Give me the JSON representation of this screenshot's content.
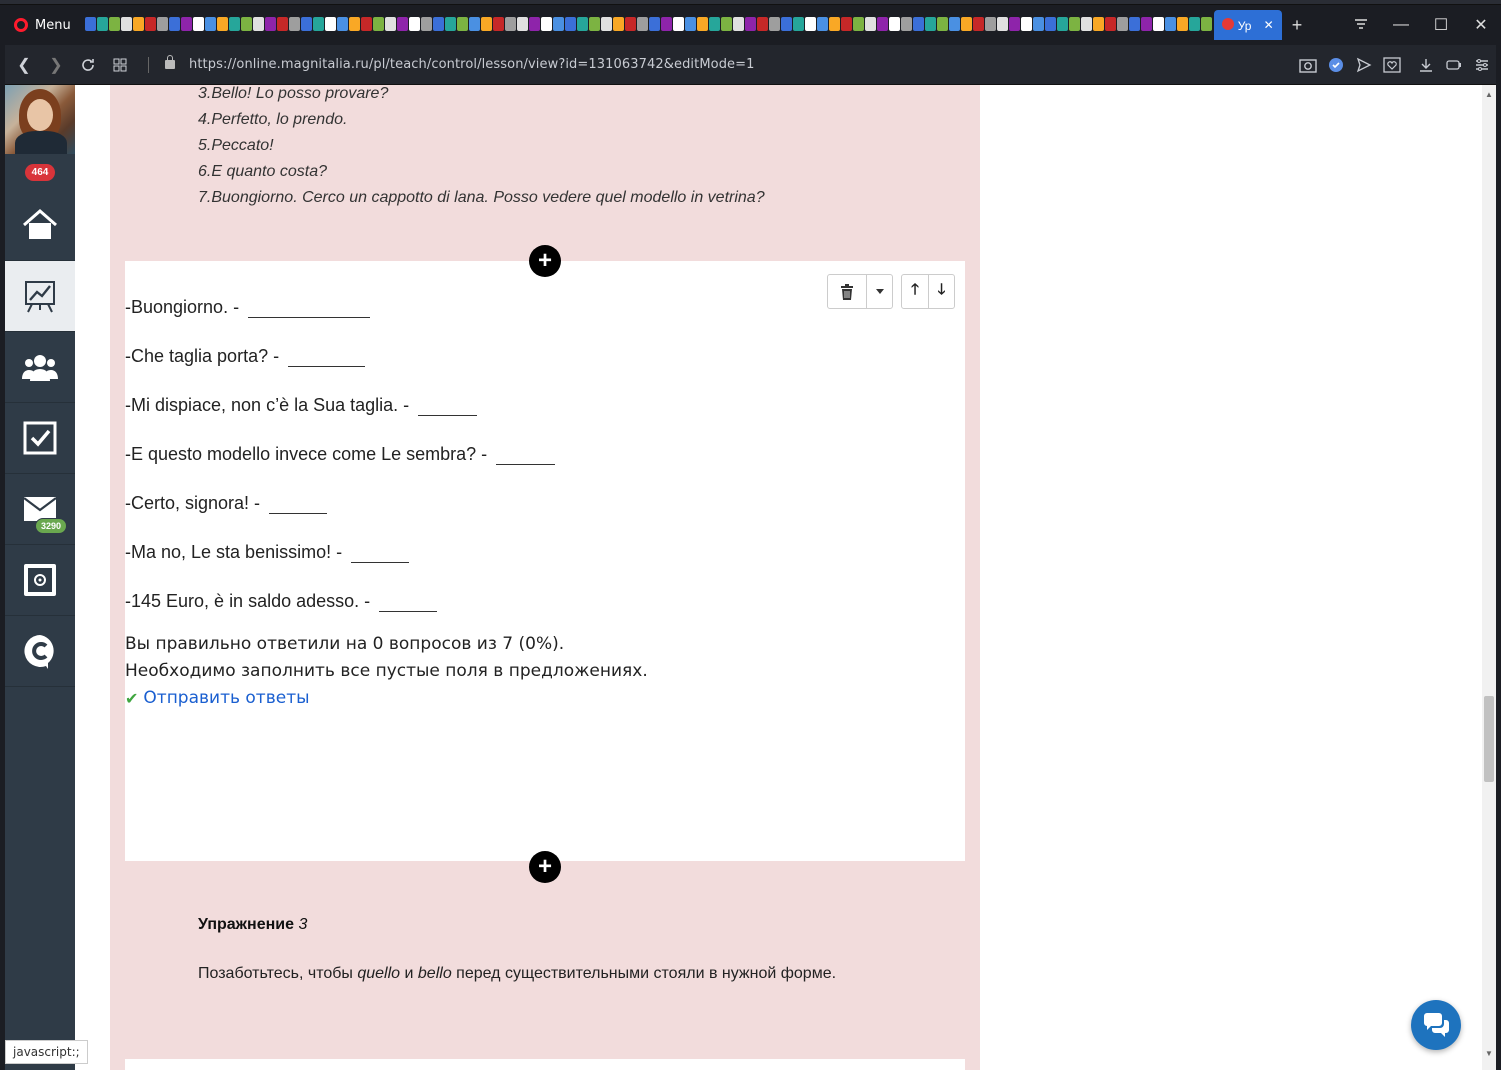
{
  "browser": {
    "menu_label": "Menu",
    "active_tab_label": "Ур",
    "url": "https://online.magnitalia.ru/pl/teach/control/lesson/view?id=131063742&editMode=1"
  },
  "sidebar": {
    "notifications_count": "464",
    "messages_count": "3290"
  },
  "previous_list": [
    "3.Bello! Lo posso provare?",
    "4.Perfetto, lo prendo.",
    "5.Peccato!",
    "6.E quanto costa?",
    "7.Buongiorno. Cerco un cappotto di lana. Posso vedere quel modello in vetrina?"
  ],
  "block": {
    "lines": [
      "-Buongiorno. -",
      "-Che taglia porta? -",
      "-Mi dispiace, non c’è la Sua taglia. -",
      "-E questo modello invece come Le sembra? -",
      "-Certo, signora! -",
      "-Ma no, Le sta benissimo! -",
      "-145 Euro, è in saldo adesso. -"
    ],
    "result_text": "Вы правильно ответили на 0 вопросов из 7 (0%).",
    "notice_text": "Необходимо заполнить все пустые поля в предложениях.",
    "submit_label": "Отправить ответы"
  },
  "exercise": {
    "title_word": "Упражнение",
    "title_number": "3",
    "text_before": "Позаботьтесь, чтобы",
    "word1": "quello",
    "text_and": "и",
    "word2": "bello",
    "text_after": "перед существительными стояли в нужной форме."
  },
  "status_bar": "javascript:;",
  "colors": {
    "pink_bg": "#f2dcdc",
    "sidebar_bg": "#2f3b47",
    "link_blue": "#1a5fd0",
    "check_green": "#3fa640",
    "chat_blue": "#1e73be"
  }
}
